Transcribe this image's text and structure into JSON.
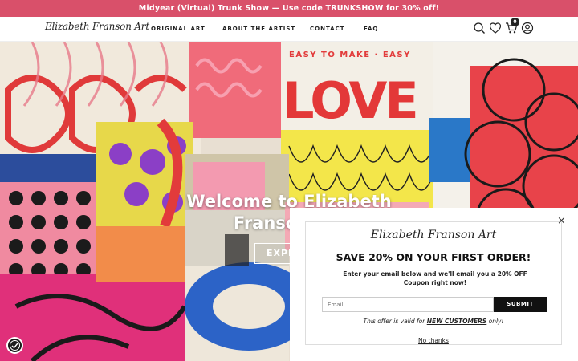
{
  "announcement": "Midyear (Virtual) Trunk Show — Use code TRUNKSHOW for 30% off!",
  "header": {
    "logo": "Elizabeth Franson Art",
    "nav": [
      "ORIGINAL ART",
      "ABOUT THE ARTIST",
      "CONTACT",
      "FAQ"
    ],
    "cart_count": "0",
    "icons": [
      "search-icon",
      "heart-icon",
      "cart-icon",
      "account-icon"
    ]
  },
  "hero": {
    "title": "Welcome to Elizabeth Franson Art",
    "button_label": "EXPLORE",
    "art_text": [
      "EASY TO MAKE · EASY",
      "LOVE"
    ]
  },
  "popup": {
    "logo": "Elizabeth Franson Art",
    "title": "SAVE 20% ON YOUR FIRST ORDER!",
    "text": "Enter your email below and we'll email you a 20% OFF Coupon right now!",
    "email_placeholder": "Email",
    "submit_label": "SUBMIT",
    "offer_prefix": "This offer is valid for ",
    "offer_highlight": "NEW CUSTOMERS",
    "offer_suffix": " only!",
    "no_thanks": "No thanks",
    "close_label": "×"
  },
  "colors": {
    "announcement_bg": "#d9506a",
    "submit_bg": "#111111"
  }
}
